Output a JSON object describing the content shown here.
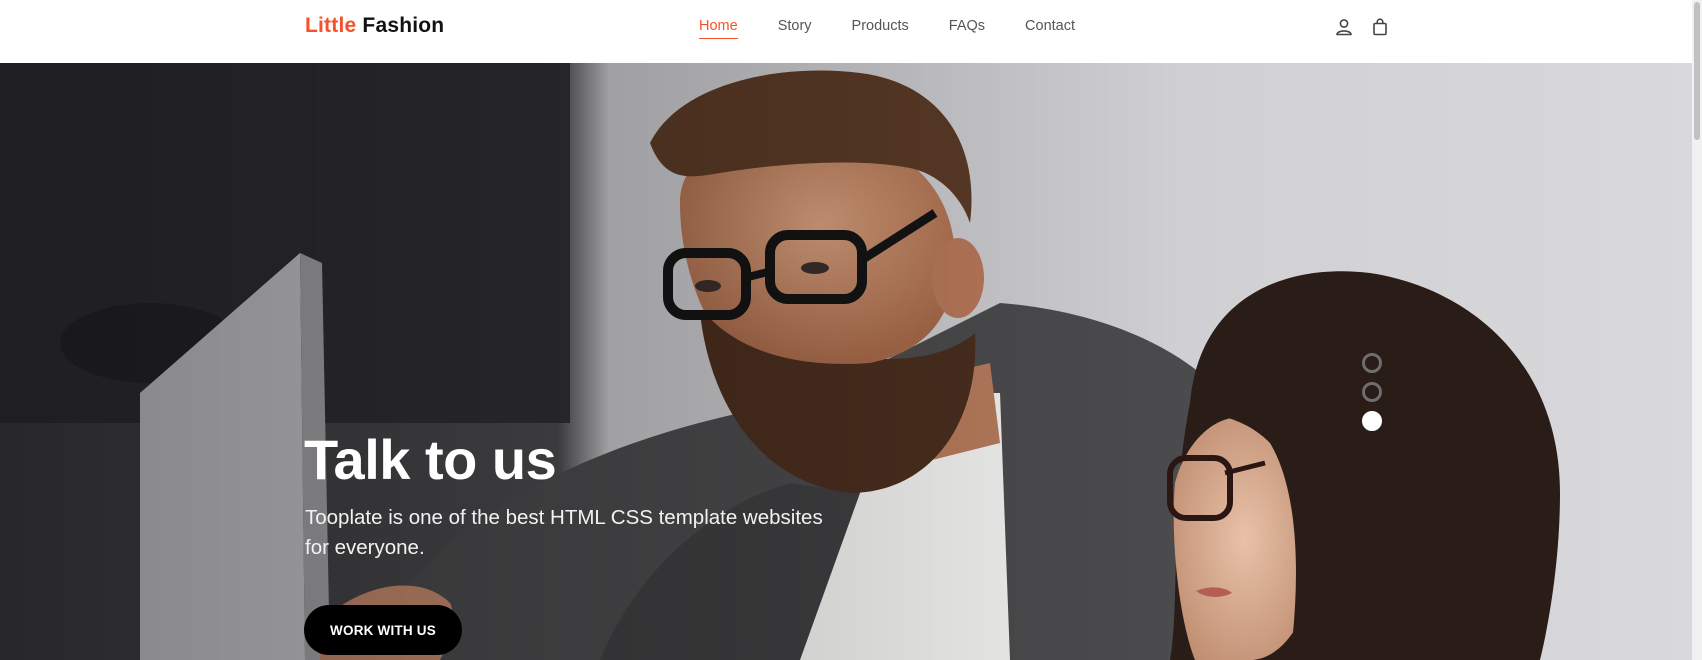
{
  "brand": {
    "first": "Little",
    "second": "Fashion"
  },
  "nav": {
    "items": [
      {
        "label": "Home",
        "active": true
      },
      {
        "label": "Story",
        "active": false
      },
      {
        "label": "Products",
        "active": false
      },
      {
        "label": "FAQs",
        "active": false
      },
      {
        "label": "Contact",
        "active": false
      }
    ],
    "icons": [
      "user-icon",
      "shopping-bag-icon"
    ]
  },
  "hero": {
    "title": "Talk to us",
    "text": "Tooplate is one of the best HTML CSS template websites for everyone.",
    "button": "WORK WITH US",
    "slides": {
      "count": 3,
      "active": 3
    }
  },
  "colors": {
    "accent": "#f65129",
    "dark": "#000000"
  }
}
